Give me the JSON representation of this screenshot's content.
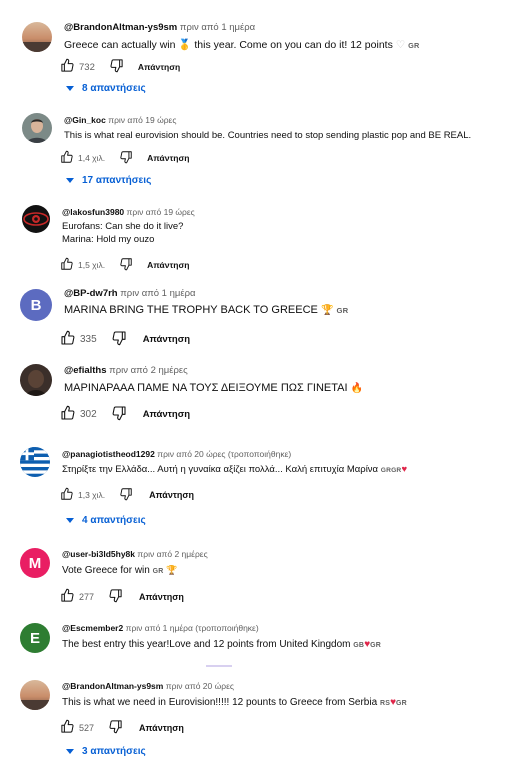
{
  "comments": [
    {
      "handle": "@BrandonAltman-ys9sm",
      "time": "πριν από 1 ημέρα",
      "lines": [
        "Greece can actually win 🥇 this year. Come on you can do it! 12 points"
      ],
      "line_suffix": [
        "♡",
        "GR"
      ],
      "likes": "732",
      "reply_label": "Απάντηση",
      "replies": "8 απαντήσεις",
      "avatar_icon": "sunset-photo-avatar"
    },
    {
      "handle": "@Gin_koc",
      "time": "πριν από 19 ώρες",
      "lines": [
        "This is what real eurovision should be.  Countries need to stop sending plastic pop and BE REAL."
      ],
      "likes": "1,4 χιλ.",
      "reply_label": "Απάντηση",
      "replies": "17 απαντήσεις",
      "avatar_icon": "person-photo-avatar"
    },
    {
      "handle": "@lakosfun3980",
      "time": "πριν από 19 ώρες",
      "lines": [
        "Eurofans: Can she do it live?",
        "Marina: Hold my ouzo"
      ],
      "likes": "1,5 χιλ.",
      "reply_label": "Απάντηση",
      "avatar_icon": "eye-avatar"
    },
    {
      "handle": "@BP-dw7rh",
      "time": "πριν από 1 ημέρα",
      "lines": [
        "MARINA BRING THE TROPHY BACK TO GREECE"
      ],
      "line_suffix": [
        "🏆",
        "GR"
      ],
      "likes": "335",
      "reply_label": "Απάντηση",
      "avatar_letter": "B",
      "avatar_color": "#5c6bc0"
    },
    {
      "handle": "@efialths",
      "time": "πριν από 2 ημέρες",
      "lines": [
        "ΜΑΡΙΝΑΡΑΑΑ ΠΑΜΕ ΝΑ ΤΟΥΣ ΔΕΙΞΟΥΜΕ ΠΩΣ ΓΙΝΕΤΑΙ"
      ],
      "line_suffix": [
        "🔥"
      ],
      "likes": "302",
      "reply_label": "Απάντηση",
      "avatar_icon": "dark-photo-avatar"
    },
    {
      "handle": "@panagiotistheod1292",
      "time": "πριν από 20 ώρες (τροποποιήθηκε)",
      "lines": [
        "Στηρίξτε την Ελλάδα... Αυτή η γυναίκα αξίζει πολλά... Καλή επιτυχία Μαρίνα"
      ],
      "line_suffix": [
        "GRGR",
        "♥"
      ],
      "likes": "1,3 χιλ.",
      "reply_label": "Απάντηση",
      "replies": "4 απαντήσεις",
      "avatar_icon": "greek-flag-avatar"
    },
    {
      "handle": "@user-bi3ld5hy8k",
      "time": "πριν από 2 ημέρες",
      "lines": [
        "Vote Greece for win"
      ],
      "line_suffix": [
        "GR",
        "🏆"
      ],
      "likes": "277",
      "reply_label": "Απάντηση",
      "avatar_letter": "M",
      "avatar_color": "#e91e63"
    },
    {
      "handle": "@Escmember2",
      "time": "πριν από 1 ημέρα (τροποποιήθηκε)",
      "lines": [
        "The best entry this year!Love and 12 points from United Kingdom"
      ],
      "line_suffix": [
        "GB",
        "♥",
        "GR"
      ],
      "avatar_letter": "E",
      "avatar_color": "#2e7d32"
    },
    {
      "handle": "@BrandonAltman-ys9sm",
      "time": "πριν από 20 ώρες",
      "lines": [
        "This is what we need in Eurovision!!!!! 12 pounts to Greece from Serbia"
      ],
      "line_suffix": [
        "RS",
        "♥",
        "GR"
      ],
      "likes": "527",
      "reply_label": "Απάντηση",
      "replies": "3 απαντήσεις",
      "avatar_icon": "sunset-photo-avatar"
    }
  ]
}
